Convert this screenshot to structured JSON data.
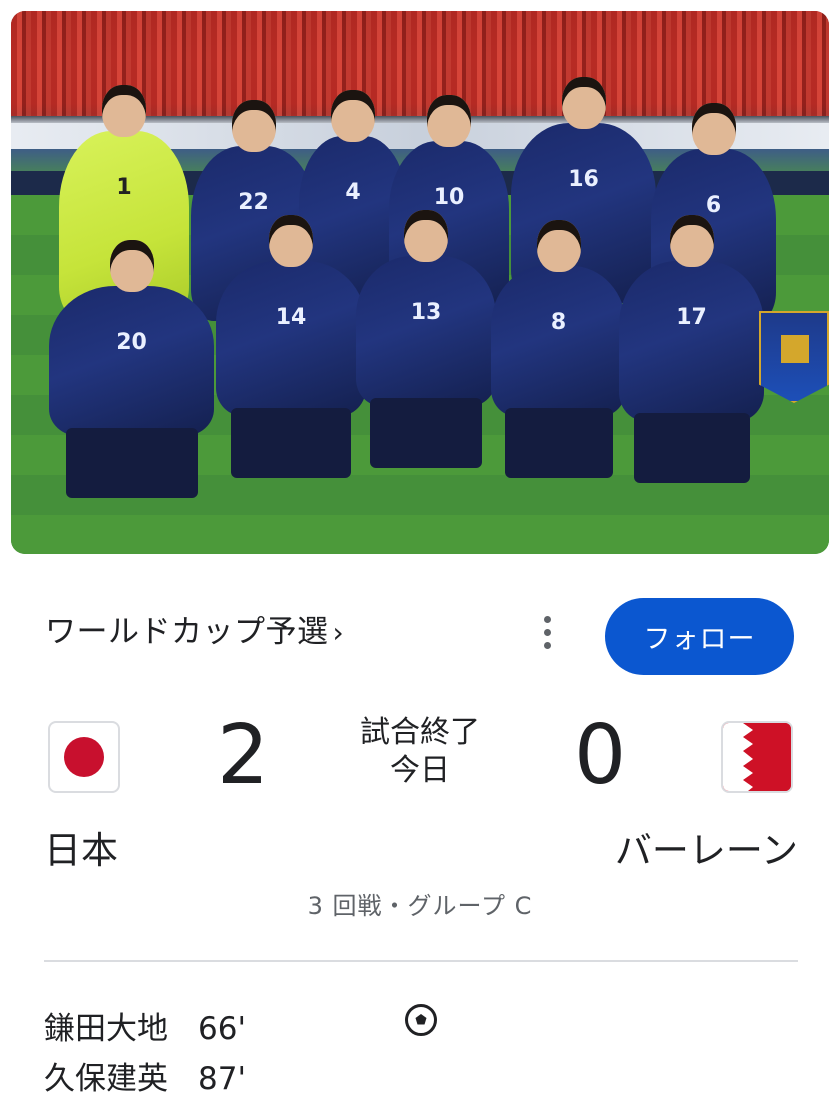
{
  "photo": {
    "alt": "",
    "jersey_numbers": [
      "1",
      "22",
      "4",
      "10",
      "16",
      "6",
      "20",
      "14",
      "13",
      "8",
      "17"
    ]
  },
  "competition": {
    "title": "ワールドカップ予選",
    "chevron": "›"
  },
  "actions": {
    "more_icon": "more-vert-icon",
    "follow_label": "フォロー"
  },
  "match": {
    "home": {
      "name": "日本",
      "score": "2",
      "flag": "japan-flag"
    },
    "away": {
      "name": "バーレーン",
      "score": "0",
      "flag": "bahrain-flag"
    },
    "status": "試合終了",
    "date": "今日",
    "round": "3 回戦・グループ C"
  },
  "scorers": [
    {
      "name": "鎌田大地",
      "minute": "66'"
    },
    {
      "name": "久保建英",
      "minute": "87'"
    }
  ],
  "colors": {
    "accent": "#0b57d0",
    "japan_red": "#c8102e",
    "bahrain_red": "#ce1126"
  }
}
